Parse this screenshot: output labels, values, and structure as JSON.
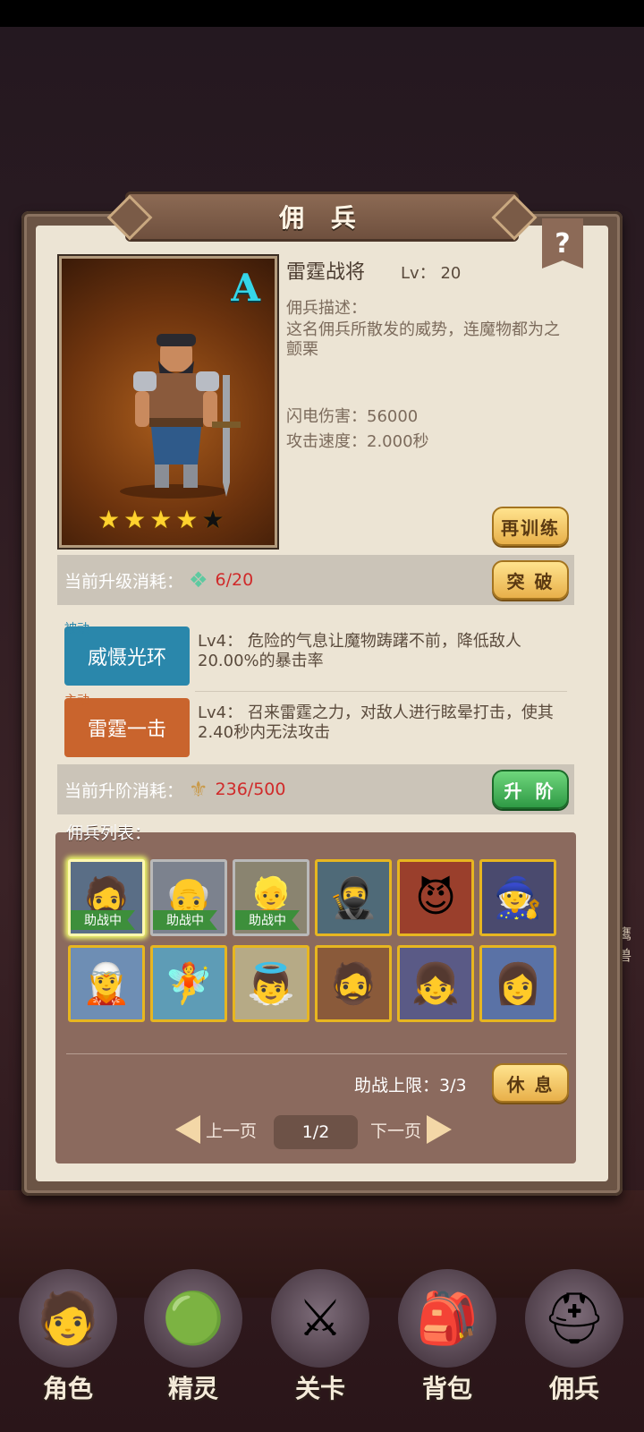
{
  "title": "佣 兵",
  "help": "?",
  "mercenary": {
    "grade": "A",
    "name": "雷霆战将",
    "lv_label": "Lv：",
    "lv_value": "20",
    "desc_label": "佣兵描述：",
    "desc": "这名佣兵所散发的威势，连魔物都为之颤栗",
    "stat1": "闪电伤害：56000",
    "stat2": "攻击速度：2.000秒",
    "stars_filled": 4,
    "stars_total": 5
  },
  "buttons": {
    "retrain": "再训练",
    "breakthrough": "突 破",
    "advance": "升 阶",
    "rest": "休 息"
  },
  "upgrade_cost": {
    "label": "当前升级消耗：",
    "value": "6/20",
    "icon": "green-crystal-icon"
  },
  "advance_cost": {
    "label": "当前升阶消耗：",
    "value": "236/500",
    "icon": "gold-emblem-icon"
  },
  "skills": [
    {
      "tag": "被动",
      "name": "威慑光环",
      "desc": "Lv4：  危险的气息让魔物踌躇不前，降低敌人20.00%的暴击率",
      "color": "#2a87ab"
    },
    {
      "tag": "主动",
      "name": "雷霆一击",
      "desc": "Lv4：  召来雷霆之力，对敌人进行眩晕打击，使其2.40秒内无法攻击",
      "color": "#c9642d"
    }
  ],
  "roster": {
    "title": "佣兵列表：",
    "assist_label": "助战中",
    "assist_limit": "助战上限：3/3",
    "prev": "上一页",
    "next": "下一页",
    "page": "1/2"
  },
  "nav": [
    "角色",
    "精灵",
    "关卡",
    "背包",
    "佣兵"
  ],
  "side_text": "鹰兽"
}
